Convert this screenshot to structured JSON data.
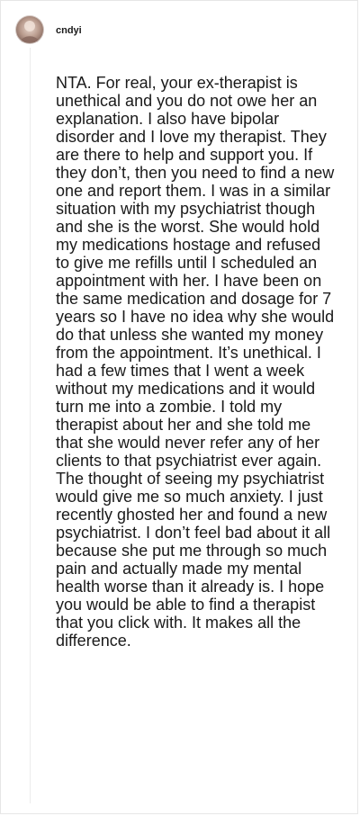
{
  "comment": {
    "author": "cndyi",
    "body": "NTA. For real, your ex-therapist is unethical and you do not owe her an explanation. I also have bipolar disorder and I love my therapist. They are there to help and support you. If they don’t, then you need to find a new one and report them. I was in a similar situation with my psychiatrist though and she is the worst. She would hold my medications hostage and refused to give me refills until I scheduled an appointment with her. I have been on the same medication and dosage for 7 years so I have no idea why she would do that unless she wanted my money from the appointment. It’s unethical. I had a few times that I went a week without my medications and it would turn me into a zombie. I told my therapist about her and she told me that she would never refer any of her clients to that psychiatrist ever again. The thought of seeing my psychiatrist would give me so much anxiety. I just recently ghosted her and found a new psychiatrist. I don’t feel bad about it all because she put me through so much pain and actually made my mental health worse than it already is. I hope you would be able to find a therapist that you click with. It makes all the difference."
  },
  "colors": {
    "text": "#1a1a1a",
    "border": "#e6e6e6",
    "thread_line": "#ececec",
    "avatar_bg": "#b89a8c"
  }
}
